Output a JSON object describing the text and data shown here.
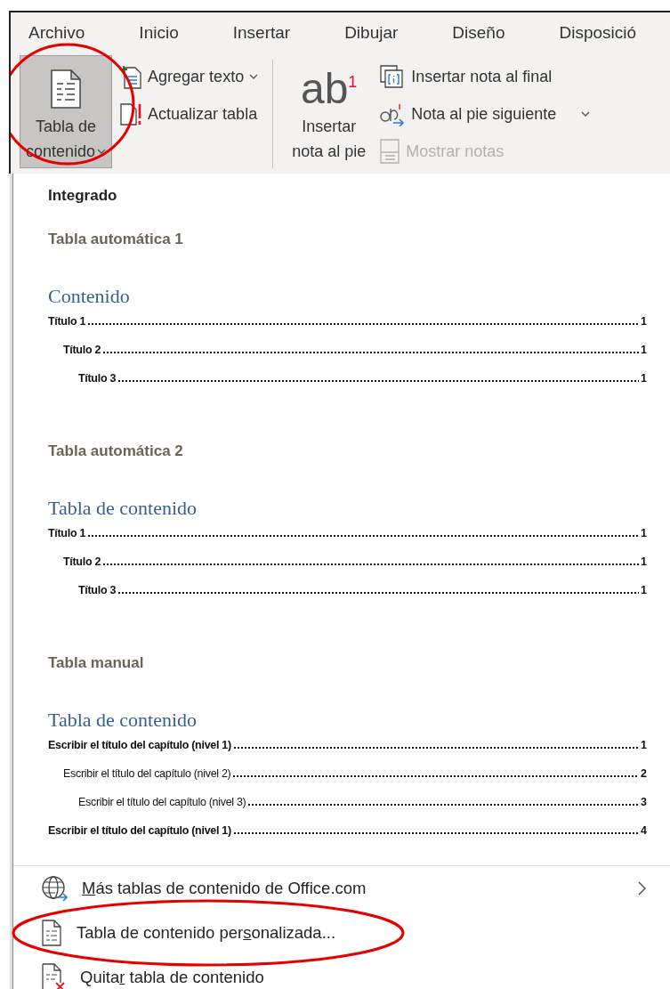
{
  "ribbon": {
    "tabs": [
      {
        "label": "Archivo",
        "selected": false
      },
      {
        "label": "Inicio",
        "selected": false
      },
      {
        "label": "Insertar",
        "selected": false
      },
      {
        "label": "Dibujar",
        "selected": false
      },
      {
        "label": "Diseño",
        "selected": false
      },
      {
        "label": "Disposició",
        "selected": false
      }
    ],
    "groups": [
      {
        "large": {
          "kind": "toc",
          "label_lines": [
            "Tabla de",
            "contenido"
          ],
          "dropdown": true,
          "pressed": true,
          "highlighted": true
        },
        "small": [
          {
            "kind": "add-text",
            "label": "Agregar texto",
            "dropdown": true,
            "disabled": false
          },
          {
            "kind": "update",
            "label": "Actualizar tabla",
            "dropdown": false,
            "disabled": false
          }
        ]
      },
      {
        "large": {
          "kind": "footnote",
          "icon_text": "ab",
          "icon_superscript": "1",
          "label_lines": [
            "Insertar",
            "nota al pie"
          ],
          "dropdown": false,
          "pressed": false,
          "highlighted": false
        },
        "small": [
          {
            "kind": "endnote",
            "label": "Insertar nota al final",
            "dropdown": false,
            "disabled": false
          },
          {
            "kind": "next-note",
            "label": "Nota al pie siguiente",
            "dropdown": true,
            "disabled": false
          },
          {
            "kind": "show-notes",
            "label": "Mostrar notas",
            "dropdown": false,
            "disabled": true
          }
        ]
      }
    ]
  },
  "menu": {
    "section_header": "Integrado",
    "galleries": [
      {
        "title": "Tabla automática 1",
        "heading": "Contenido",
        "entries": [
          {
            "text": "Título 1",
            "page": "1",
            "bold": true,
            "children": [
              {
                "text": "Título 2",
                "page": "1",
                "bold": true,
                "children": [
                  {
                    "text": "Título 3",
                    "page": "1",
                    "bold": true
                  }
                ]
              }
            ]
          }
        ]
      },
      {
        "title": "Tabla automática 2",
        "heading": "Tabla de contenido",
        "entries": [
          {
            "text": "Título 1",
            "page": "1",
            "bold": true,
            "children": [
              {
                "text": "Título 2",
                "page": "1",
                "bold": true,
                "children": [
                  {
                    "text": "Título 3",
                    "page": "1",
                    "bold": true
                  }
                ]
              }
            ]
          }
        ]
      },
      {
        "title": "Tabla manual",
        "heading": "Tabla de contenido",
        "entries": [
          {
            "text": "Escribir el título del capítulo (nivel 1)",
            "page": "1",
            "bold": true,
            "children": [
              {
                "text": "Escribir el título del capítulo (nivel 2)",
                "page": "2",
                "bold": false,
                "children": [
                  {
                    "text": "Escribir el título del capítulo (nivel 3)",
                    "page": "3",
                    "bold": false
                  }
                ]
              }
            ]
          },
          {
            "text": "Escribir el título del capítulo (nivel 1)",
            "page": "4",
            "bold": true
          }
        ]
      }
    ],
    "commands": [
      {
        "kind": "globe",
        "access_key": "M",
        "label_after": "ás tablas de contenido de Office.com",
        "submenu": true,
        "highlighted": false
      },
      {
        "kind": "document",
        "label_before": "Tabla de contenido per",
        "access_key": "s",
        "label_after": "onalizada...",
        "submenu": false,
        "highlighted": true
      },
      {
        "kind": "remove",
        "label_before": "Quita",
        "access_key": "r",
        "label_after": " tabla de contenido",
        "submenu": false,
        "highlighted": false
      }
    ]
  }
}
